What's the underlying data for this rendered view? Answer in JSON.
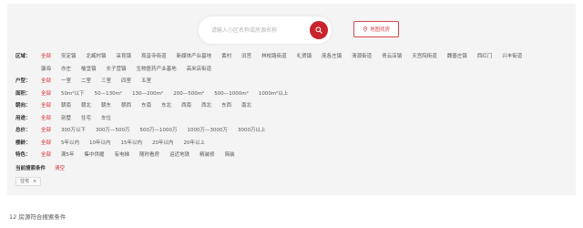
{
  "search": {
    "placeholder": "请输入小区名称或房源名称"
  },
  "map_button": {
    "label": "地图找房"
  },
  "filters": [
    {
      "label": "区域：",
      "options": [
        "全部",
        "安定镇",
        "北臧村镇",
        "采育镇",
        "观音寺街道",
        "新媒体产业基地",
        "黄村",
        "旧宫",
        "林校路街道",
        "礼贤镇",
        "庞各庄镇",
        "清源街道",
        "青云店镇",
        "天宫院街道",
        "魏善庄镇",
        "西红门",
        "兴丰街道",
        "瀛海",
        "亦庄",
        "榆垡镇",
        "长子营镇",
        "生物医药产业基地",
        "高米店街道"
      ],
      "active": 0
    },
    {
      "label": "户型：",
      "options": [
        "全部",
        "一室",
        "二室",
        "三室",
        "四室",
        "五室"
      ],
      "active": 0
    },
    {
      "label": "面积：",
      "options": [
        "全部",
        "50m²以下",
        "50—130m²",
        "130—200m²",
        "200—500m²",
        "500—1000m²",
        "1000m²以上"
      ],
      "active": 0
    },
    {
      "label": "朝向：",
      "options": [
        "全部",
        "朝南",
        "朝北",
        "朝东",
        "朝西",
        "东南",
        "东北",
        "西南",
        "西北",
        "东西",
        "南北"
      ],
      "active": 0
    },
    {
      "label": "用途：",
      "options": [
        "全部",
        "别墅",
        "住宅",
        "车位"
      ],
      "active": 0
    },
    {
      "label": "总价：",
      "options": [
        "全部",
        "300万以下",
        "300万—500万",
        "500万—1000万",
        "1000万—3000万",
        "3000万以上"
      ],
      "active": 0
    },
    {
      "label": "楼龄：",
      "options": [
        "全部",
        "5年以内",
        "10年以内",
        "15年以内",
        "20年以内",
        "20年以上"
      ],
      "active": 0
    },
    {
      "label": "特色：",
      "options": [
        "全部",
        "满5年",
        "集中供暖",
        "有电梯",
        "随时看房",
        "运近地铁",
        "精装修",
        "简装"
      ],
      "active": 0
    }
  ],
  "conditions": {
    "label": "当前搜索条件",
    "clear_label": "清空",
    "tags": [
      {
        "text": "住宅",
        "close": "×"
      }
    ]
  },
  "result": {
    "text": "12 房源符合搜索条件"
  },
  "colors": {
    "accent": "#d9232d",
    "search_button": "#c9232d",
    "panel_bg": "#f4f4f4"
  }
}
